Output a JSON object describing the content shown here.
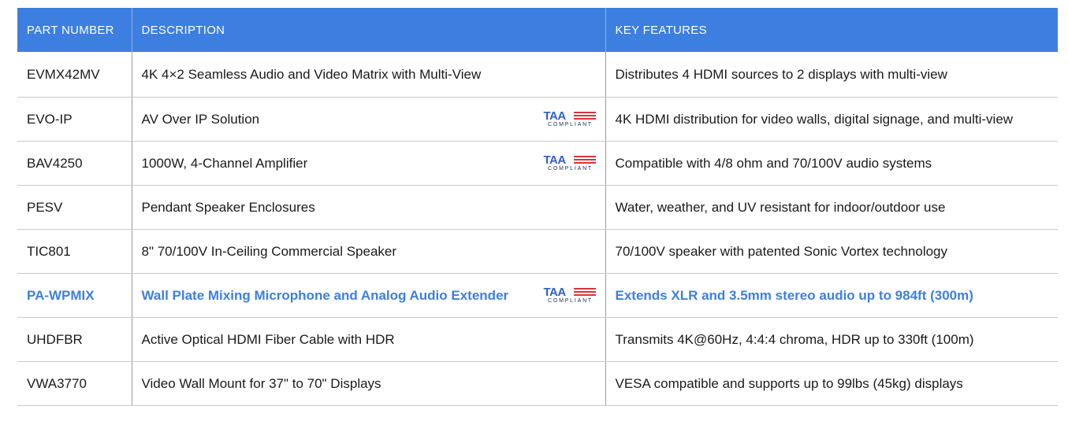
{
  "table": {
    "headers": [
      "PART NUMBER",
      "DESCRIPTION",
      "KEY FEATURES"
    ],
    "rows": [
      {
        "part": "EVMX42MV",
        "description": "4K 4×2 Seamless Audio and Video Matrix with Multi-View",
        "features": "Distributes 4 HDMI sources to 2 displays with multi-view",
        "taa": false
      },
      {
        "part": "EVO-IP",
        "description": "AV Over IP Solution",
        "features": "4K HDMI distribution for video walls, digital signage, and multi-view",
        "taa": true
      },
      {
        "part": "BAV4250",
        "description": "1000W, 4-Channel Amplifier",
        "features": "Compatible with 4/8 ohm and 70/100V audio systems",
        "taa": true
      },
      {
        "part": "PESV",
        "description": "Pendant Speaker Enclosures",
        "features": "Water, weather, and UV resistant for indoor/outdoor use",
        "taa": false
      },
      {
        "part": "TIC801",
        "description": "8\" 70/100V In-Ceiling Commercial Speaker",
        "features": "70/100V speaker with patented Sonic Vortex technology",
        "taa": false
      },
      {
        "part": "PA-WPMIX",
        "description": "Wall Plate Mixing Microphone and Analog Audio Extender",
        "features": "Extends XLR and 3.5mm stereo audio up to 984ft (300m)",
        "taa": true
      },
      {
        "part": "UHDFBR",
        "description": "Active Optical HDMI Fiber Cable with HDR",
        "features": "Transmits 4K@60Hz, 4:4:4 chroma, HDR up to 330ft (100m)",
        "taa": false
      },
      {
        "part": "VWA3770",
        "description": "Video Wall Mount for 37\" to 70\" Displays",
        "features": "VESA compatible and supports up to 99lbs (45kg) displays",
        "taa": false
      }
    ]
  },
  "taa_badge": {
    "mark": "TAA",
    "sub": "COMPLIANT"
  },
  "colors": {
    "header_bg": "#3d7fe0",
    "highlight_text": "#3d7fe0",
    "taa_red": "#d8343b",
    "taa_blue": "#2f5fc9"
  }
}
